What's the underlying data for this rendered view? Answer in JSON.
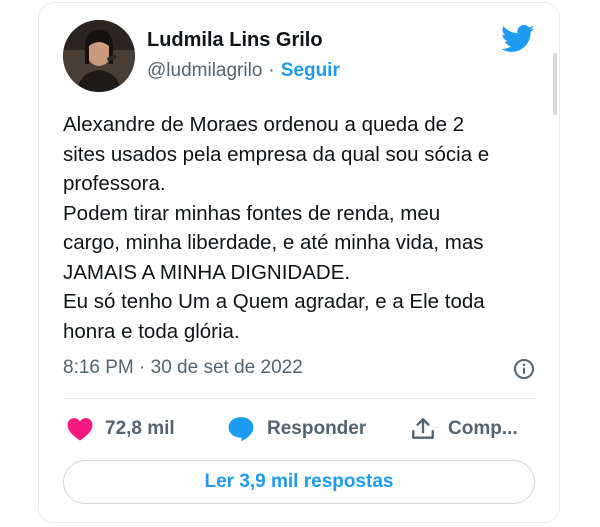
{
  "author": {
    "name": "Ludmila Lins Grilo",
    "handle": "@ludmilagrilo",
    "separator": "·",
    "follow_label": "Seguir"
  },
  "tweet": {
    "lines": [
      "Alexandre de Moraes ordenou a queda de 2",
      "sites usados pela empresa da qual sou sócia e",
      "professora.",
      "Podem tirar minhas fontes de renda, meu",
      "cargo, minha liberdade, e até minha vida, mas",
      "JAMAIS A MINHA DIGNIDADE.",
      "Eu só tenho Um a Quem agradar, e a Ele toda",
      "honra e toda glória."
    ],
    "timestamp": "8:16 PM · 30 de set de 2022"
  },
  "actions": {
    "likes": "72,8 mil",
    "reply_label": "Responder",
    "share_label": "Comp..."
  },
  "replies_button": "Ler 3,9 mil respostas",
  "icons": {
    "twitter": "twitter-bird-icon",
    "info": "info-icon",
    "like": "heart-icon",
    "reply": "speech-bubble-icon",
    "share": "share-upload-icon"
  },
  "colors": {
    "accent": "#1d9bf0",
    "like": "#f91880",
    "text": "#0f1419",
    "muted": "#536471",
    "border": "#e7ebee"
  }
}
